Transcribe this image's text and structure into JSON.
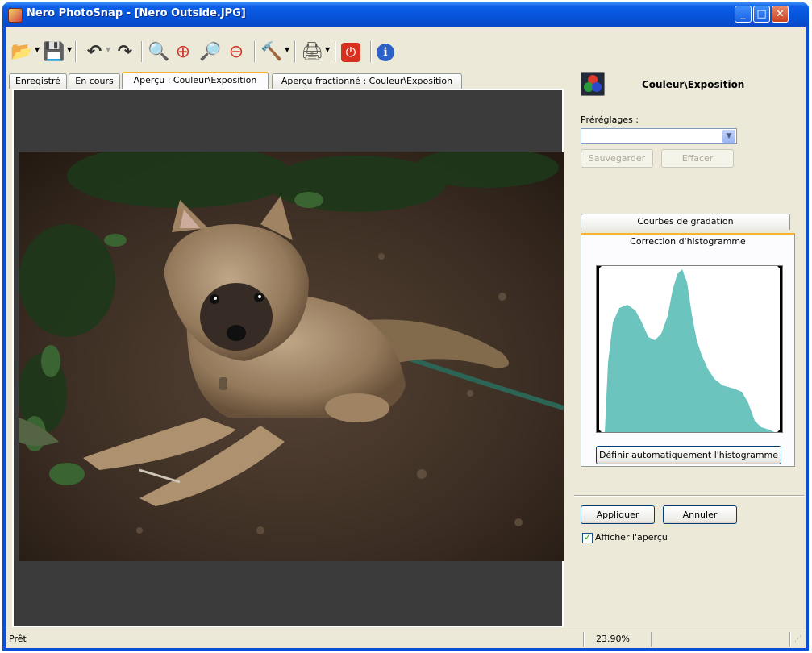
{
  "window": {
    "title": "Nero PhotoSnap - [Nero Outside.JPG]",
    "controls": {
      "minimize": "_",
      "maximize": "□",
      "close": "✕"
    }
  },
  "toolbar": {
    "tools": [
      {
        "icon": "open-folder-icon",
        "glyph": "📂",
        "dropdown": true
      },
      {
        "icon": "save-disk-icon",
        "glyph": "💾",
        "dropdown": true
      },
      {
        "icon": "undo-icon",
        "glyph": "↶",
        "dropdown": true
      },
      {
        "icon": "redo-icon",
        "glyph": "↷",
        "dropdown": false
      },
      {
        "icon": "zoom-page-icon",
        "glyph": "🔍",
        "dropdown": false
      },
      {
        "icon": "zoom-in-icon",
        "glyph": "⊕",
        "dropdown": false
      },
      {
        "icon": "zoom-fit-icon",
        "glyph": "🔎",
        "dropdown": false
      },
      {
        "icon": "zoom-out-icon",
        "glyph": "⊖",
        "dropdown": false
      },
      {
        "icon": "tools-hammer-icon",
        "glyph": "🔨",
        "dropdown": true
      },
      {
        "icon": "print-icon",
        "glyph": "🖨",
        "dropdown": true
      },
      {
        "icon": "power-icon",
        "glyph": "⏻",
        "dropdown": false
      },
      {
        "icon": "info-icon",
        "glyph": "ℹ",
        "dropdown": false
      }
    ]
  },
  "tabs": [
    {
      "label": "Enregistré"
    },
    {
      "label": "En cours"
    },
    {
      "label": "Aperçu : Couleur\\Exposition"
    },
    {
      "label": "Aperçu fractionné : Couleur\\Exposition"
    }
  ],
  "side": {
    "title": "Couleur\\Exposition",
    "presets_label": "Préréglages :",
    "presets_value": "",
    "save_label": "Sauvegarder",
    "clear_label": "Effacer",
    "panel_tabs": [
      "Courbes de gradation",
      "Correction d'histogramme"
    ],
    "auto_histogram_label": "Définir automatiquement l'histogramme",
    "apply_label": "Appliquer",
    "cancel_label": "Annuler",
    "show_preview_label": "Afficher l'aperçu",
    "show_preview_checked": true
  },
  "status": {
    "left": "Prêt",
    "zoom": "23.90%"
  },
  "colors": {
    "titlebar": "#0553d8",
    "histogram_fill": "#6cc4bf",
    "tab_accent": "#f8b331",
    "preview_bg": "#3b3b3b"
  }
}
